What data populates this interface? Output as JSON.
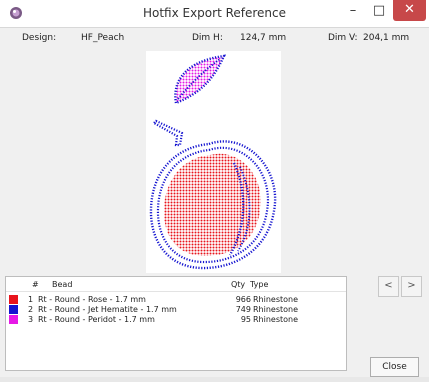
{
  "window": {
    "title": "Hotfix Export Reference",
    "minimize_glyph": "–",
    "maximize_glyph": "□",
    "close_glyph": "✕",
    "close_color": "#c74849"
  },
  "design": {
    "label": "Design:",
    "name": "HF_Peach",
    "dim_h_label": "Dim H:",
    "dim_h_value": "124,7 mm",
    "dim_v_label": "Dim V:",
    "dim_v_value": "204,1 mm"
  },
  "table": {
    "headers": {
      "num": "#",
      "bead": "Bead",
      "qty": "Qty",
      "type": "Type"
    },
    "rows": [
      {
        "num": "1",
        "bead": "Rt - Round - Rose - 1.7 mm",
        "qty": "966",
        "type": "Rhinestone",
        "color": "#e8141c"
      },
      {
        "num": "2",
        "bead": "Rt - Round - Jet Hematite - 1.7 mm",
        "qty": "749",
        "type": "Rhinestone",
        "color": "#1414d0"
      },
      {
        "num": "3",
        "bead": "Rt - Round - Peridot - 1.7 mm",
        "qty": "95",
        "type": "Rhinestone",
        "color": "#e619e6"
      }
    ]
  },
  "nav": {
    "prev_label": "<",
    "next_label": ">"
  },
  "buttons": {
    "close_label": "Close"
  }
}
